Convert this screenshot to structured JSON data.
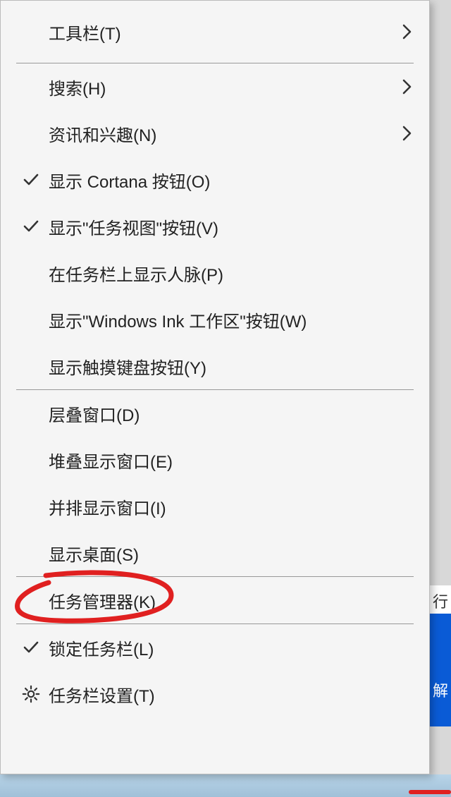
{
  "menu": {
    "groups": [
      [
        {
          "label": "工具栏(T)",
          "submenu": true,
          "checked": false,
          "icon": null
        }
      ],
      [
        {
          "label": "搜索(H)",
          "submenu": true,
          "checked": false,
          "icon": null
        },
        {
          "label": "资讯和兴趣(N)",
          "submenu": true,
          "checked": false,
          "icon": null
        },
        {
          "label": "显示 Cortana 按钮(O)",
          "submenu": false,
          "checked": true,
          "icon": null
        },
        {
          "label": "显示\"任务视图\"按钮(V)",
          "submenu": false,
          "checked": true,
          "icon": null
        },
        {
          "label": "在任务栏上显示人脉(P)",
          "submenu": false,
          "checked": false,
          "icon": null
        },
        {
          "label": "显示\"Windows Ink 工作区\"按钮(W)",
          "submenu": false,
          "checked": false,
          "icon": null
        },
        {
          "label": "显示触摸键盘按钮(Y)",
          "submenu": false,
          "checked": false,
          "icon": null
        }
      ],
      [
        {
          "label": "层叠窗口(D)",
          "submenu": false,
          "checked": false,
          "icon": null
        },
        {
          "label": "堆叠显示窗口(E)",
          "submenu": false,
          "checked": false,
          "icon": null
        },
        {
          "label": "并排显示窗口(I)",
          "submenu": false,
          "checked": false,
          "icon": null
        },
        {
          "label": "显示桌面(S)",
          "submenu": false,
          "checked": false,
          "icon": null
        }
      ],
      [
        {
          "label": "任务管理器(K)",
          "submenu": false,
          "checked": false,
          "icon": null
        }
      ],
      [
        {
          "label": "锁定任务栏(L)",
          "submenu": false,
          "checked": true,
          "icon": null
        },
        {
          "label": "任务栏设置(T)",
          "submenu": false,
          "checked": false,
          "icon": "gear"
        }
      ]
    ]
  },
  "bg": {
    "right_text_top": "行",
    "right_text_blue": "解"
  },
  "highlight": {
    "target_label": "任务管理器(K)"
  }
}
